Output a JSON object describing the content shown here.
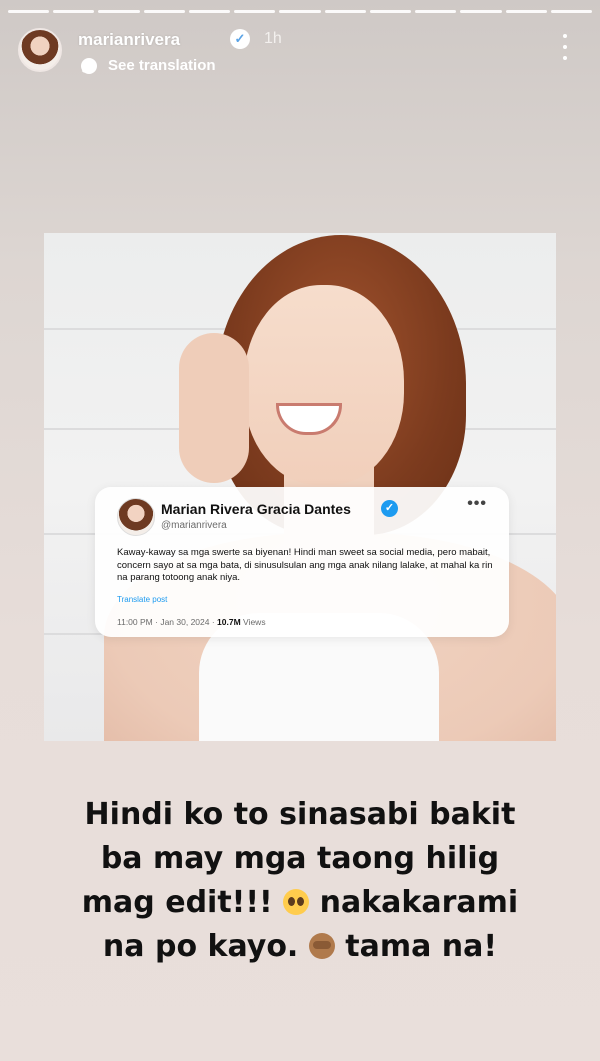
{
  "story": {
    "progress_segments": 13,
    "username": "marianrivera",
    "time_ago": "1h",
    "see_translation": "See translation"
  },
  "tweet": {
    "name": "Marian Rivera Gracia Dantes",
    "handle": "@marianrivera",
    "body": "Kaway-kaway sa mga swerte sa biyenan! Hindi man sweet sa social media, pero mabait, concern sayo at sa mga bata, di sinusulsulan ang mga anak nilang lalake, at mahal ka rin na parang totoong anak niya.",
    "translate": "Translate post",
    "time": "11:00 PM",
    "date": "Jan 30, 2024",
    "views_count": "10.7M",
    "views_label": "Views"
  },
  "caption": {
    "line1": "Hindi ko to sinasabi bakit",
    "line2": "ba may mga taong hilig",
    "line3_a": "mag edit!!!",
    "line3_b": "nakakarami",
    "line4_a": "na po kayo.",
    "line4_b": "tama na!",
    "emoji_1": "pleading-face",
    "emoji_2": "see-no-evil-monkey"
  },
  "colors": {
    "verified_blue": "#1d9bf0",
    "caption_text": "#111111"
  }
}
